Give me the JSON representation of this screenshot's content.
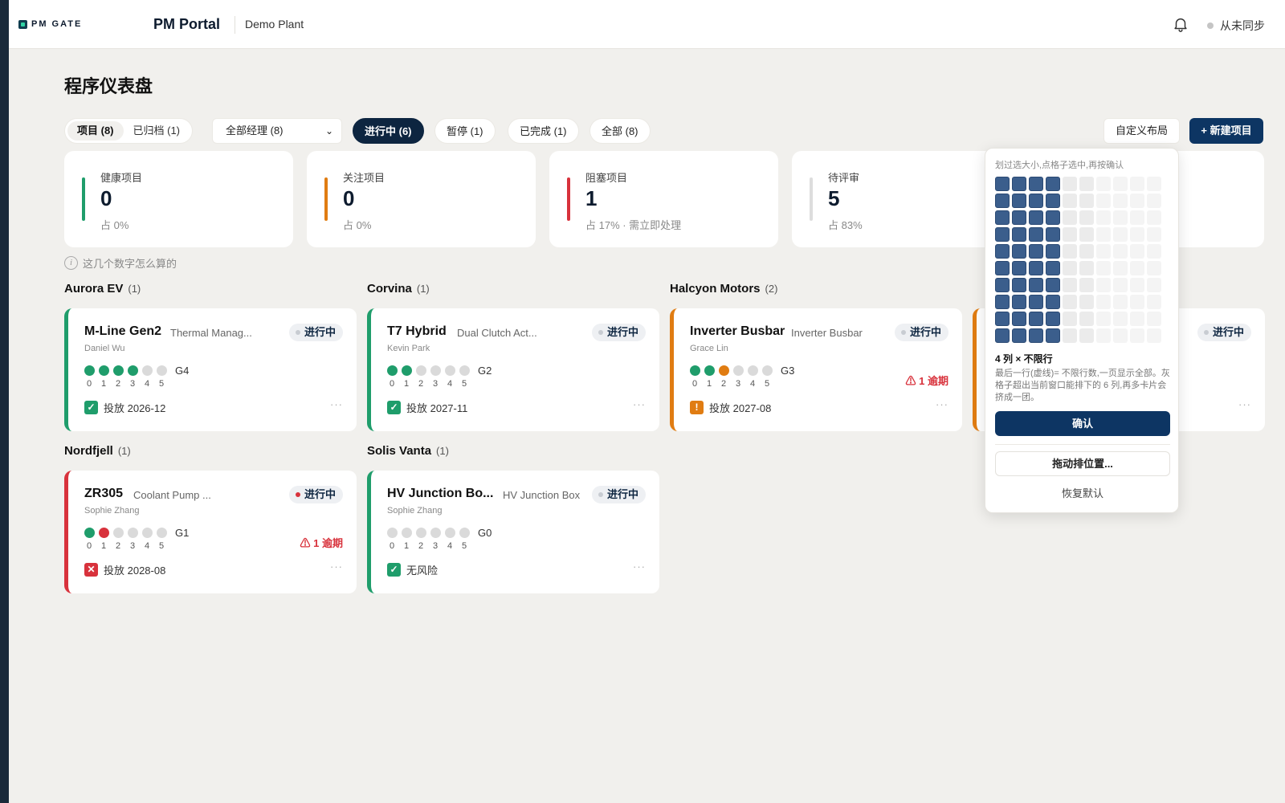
{
  "header": {
    "logo_text": "PM GATE",
    "app_title": "PM Portal",
    "plant": "Demo Plant",
    "sync_status": "从未同步"
  },
  "page_title": "程序仪表盘",
  "toolbar": {
    "view_tabs": [
      {
        "label": "项目 (8)",
        "active": true
      },
      {
        "label": "已归档 (1)",
        "active": false
      }
    ],
    "manager_select": "全部经理 (8)",
    "status_filters": [
      {
        "label": "进行中 (6)",
        "active": true
      },
      {
        "label": "暂停 (1)",
        "active": false
      },
      {
        "label": "已完成 (1)",
        "active": false
      },
      {
        "label": "全部 (8)",
        "active": false
      }
    ],
    "customize_label": "自定义布局",
    "new_project_label": "+ 新建项目"
  },
  "stats": [
    {
      "label": "健康项目",
      "value": "0",
      "sub": "占 0%",
      "color": "#1f9d6b"
    },
    {
      "label": "关注项目",
      "value": "0",
      "sub": "占 0%",
      "color": "#e07c12"
    },
    {
      "label": "阻塞项目",
      "value": "1",
      "sub": "占 17% · 需立即处理",
      "color": "#d8323c"
    },
    {
      "label": "待评审",
      "value": "5",
      "sub": "占 83%",
      "color": "#dddddd"
    }
  ],
  "help_text": "这几个数字怎么算的",
  "groups": [
    {
      "name": "Aurora EV",
      "count": "(1)"
    },
    {
      "name": "Corvina",
      "count": "(1)"
    },
    {
      "name": "Halcyon Motors",
      "count": "(2)"
    },
    {
      "name": "Nordfjell",
      "count": "(1)"
    },
    {
      "name": "Solis Vanta",
      "count": "(1)"
    }
  ],
  "projects": [
    {
      "name": "M-Line Gen2",
      "sub": "Thermal Manag...",
      "owner": "Daniel Wu",
      "status": "进行中",
      "gate": "G4",
      "milestone": "投放 2026-12",
      "overdue": ""
    },
    {
      "name": "T7 Hybrid",
      "sub": "Dual Clutch Act...",
      "owner": "Kevin Park",
      "status": "进行中",
      "gate": "G2",
      "milestone": "投放 2027-11",
      "overdue": ""
    },
    {
      "name": "Inverter Busbar",
      "sub": "Inverter Busbar",
      "owner": "Grace Lin",
      "status": "进行中",
      "gate": "G3",
      "milestone": "投放 2027-08",
      "overdue": "⚠ 1 逾期"
    },
    {
      "name": "",
      "sub": "",
      "owner": "",
      "status": "进行中",
      "gate": "",
      "milestone": "",
      "overdue": ""
    },
    {
      "name": "ZR305",
      "sub": "Coolant Pump ...",
      "owner": "Sophie Zhang",
      "status": "进行中",
      "gate": "G1",
      "milestone": "投放 2028-08",
      "overdue": "⚠ 1 逾期"
    },
    {
      "name": "HV Junction Bo...",
      "sub": "HV Junction Box",
      "owner": "Sophie Zhang",
      "status": "进行中",
      "gate": "G0",
      "milestone": "无风险",
      "overdue": ""
    }
  ],
  "gate_numbers": [
    "0",
    "1",
    "2",
    "3",
    "4",
    "5"
  ],
  "more_label": "···",
  "layout_popover": {
    "hint": "划过选大小,点格子选中,再按确认",
    "size_label": "4 列 × 不限行",
    "note": "最后一行(虚线)= 不限行数,一页显示全部。灰格子超出当前窗口能排下的 6 列,再多卡片会挤成一团。",
    "confirm_label": "确认",
    "drag_label": "拖动排位置...",
    "reset_label": "恢复默认",
    "selected_columns": 4,
    "grid_columns": 10,
    "grid_rows": 10
  },
  "colors": {
    "green": "#1f9d6b",
    "orange": "#e07c12",
    "red": "#d8323c",
    "navy": "#0d3563"
  }
}
